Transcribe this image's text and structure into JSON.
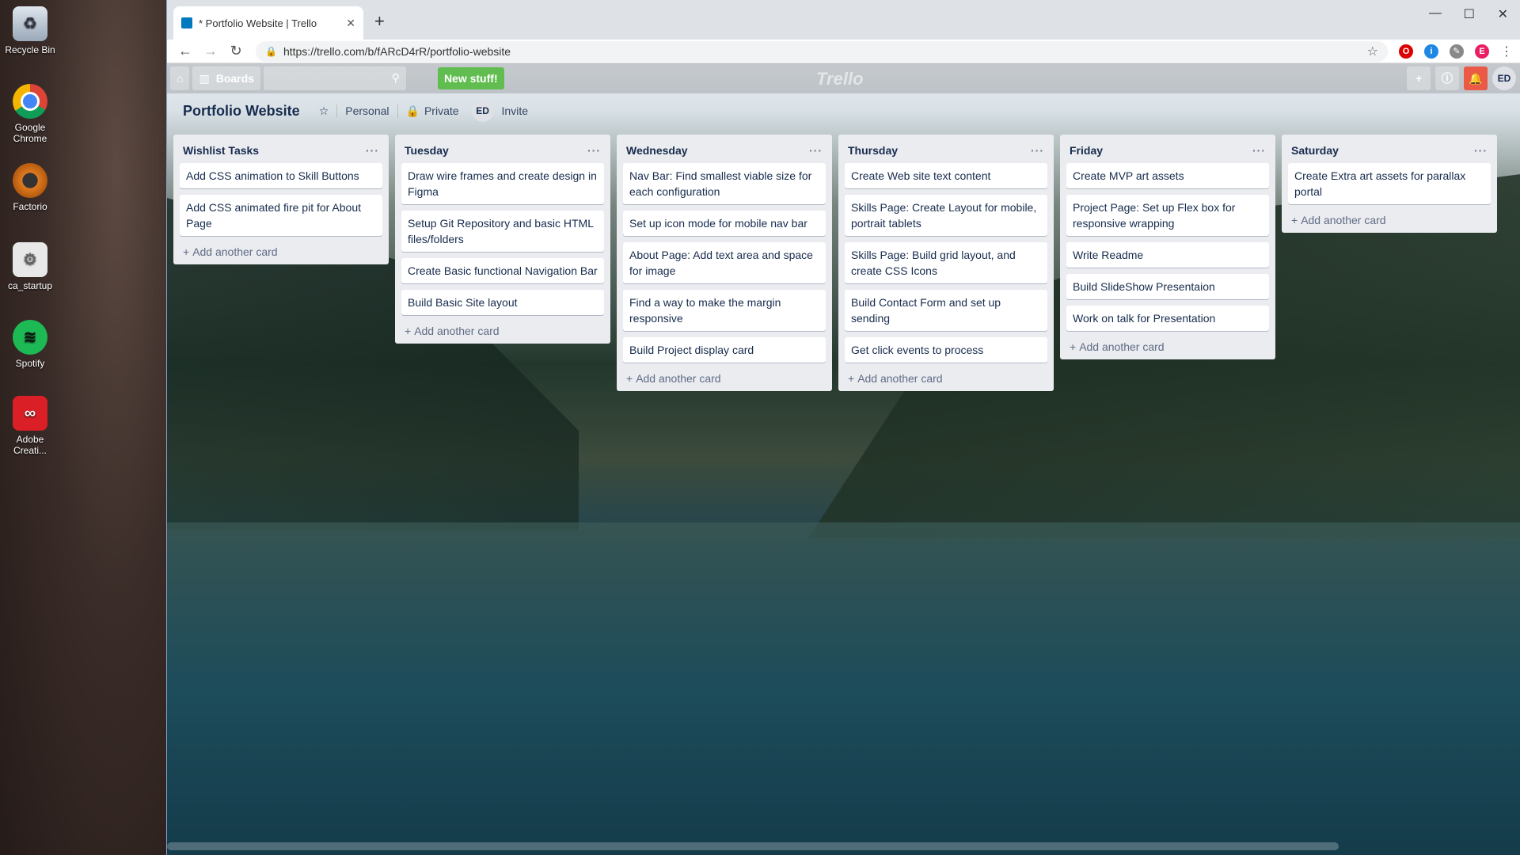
{
  "desktop": {
    "icons": [
      {
        "label": "Recycle Bin",
        "icon": "recycle-bin-icon"
      },
      {
        "label": "Google Chrome",
        "icon": "chrome-icon"
      },
      {
        "label": "Factorio",
        "icon": "factorio-icon"
      },
      {
        "label": "ca_startup",
        "icon": "ca-startup-icon"
      },
      {
        "label": "Spotify",
        "icon": "spotify-icon"
      },
      {
        "label": "Adobe Creati...",
        "icon": "adobe-creative-cloud-icon"
      }
    ]
  },
  "browser": {
    "tab_title": "* Portfolio Website | Trello",
    "url": "https://trello.com/b/fARcD4rR/portfolio-website",
    "new_tab_glyph": "+",
    "close_glyph": "✕"
  },
  "trello_header": {
    "home_glyph": "⌂",
    "boards_label": "Boards",
    "search_glyph": "⚲",
    "new_stuff_label": "New stuff!",
    "logo_text": "Trello",
    "profile_initials": "ED",
    "colors": {
      "new_stuff": "#61bd4f",
      "notification": "#eb5a46"
    }
  },
  "board": {
    "title": "Portfolio Website",
    "team": "Personal",
    "visibility": "Private",
    "member_initials": "ED",
    "invite_label": "Invite"
  },
  "lists": [
    {
      "title": "Wishlist Tasks",
      "cards": [
        "Add CSS animation to Skill Buttons",
        "Add CSS animated fire pit for About Page"
      ],
      "add_label": "Add another card"
    },
    {
      "title": "Tuesday",
      "cards": [
        "Draw wire frames and create design in Figma",
        "Setup Git Repository and basic HTML files/folders",
        "Create Basic functional Navigation Bar",
        "Build Basic Site layout"
      ],
      "add_label": "Add another card"
    },
    {
      "title": "Wednesday",
      "cards": [
        "Nav Bar: Find smallest viable size for each configuration",
        "Set up icon mode for mobile nav bar",
        "About Page: Add text area and space for image",
        "Find a way to make the margin responsive",
        "Build Project display card"
      ],
      "add_label": "Add another card"
    },
    {
      "title": "Thursday",
      "cards": [
        "Create Web site text content",
        "Skills Page: Create Layout for mobile, portrait tablets",
        "Skills Page: Build grid layout, and create CSS Icons",
        "Build Contact Form and set up sending",
        "Get click events to process"
      ],
      "add_label": "Add another card"
    },
    {
      "title": "Friday",
      "cards": [
        "Create MVP art assets",
        "Project Page: Set up Flex box for responsive wrapping",
        "Write Readme",
        "Build SlideShow Presentaion",
        "Work on talk for Presentation"
      ],
      "add_label": "Add another card"
    },
    {
      "title": "Saturday",
      "cards": [
        "Create Extra art assets for parallax portal"
      ],
      "add_label": "Add another card"
    }
  ]
}
